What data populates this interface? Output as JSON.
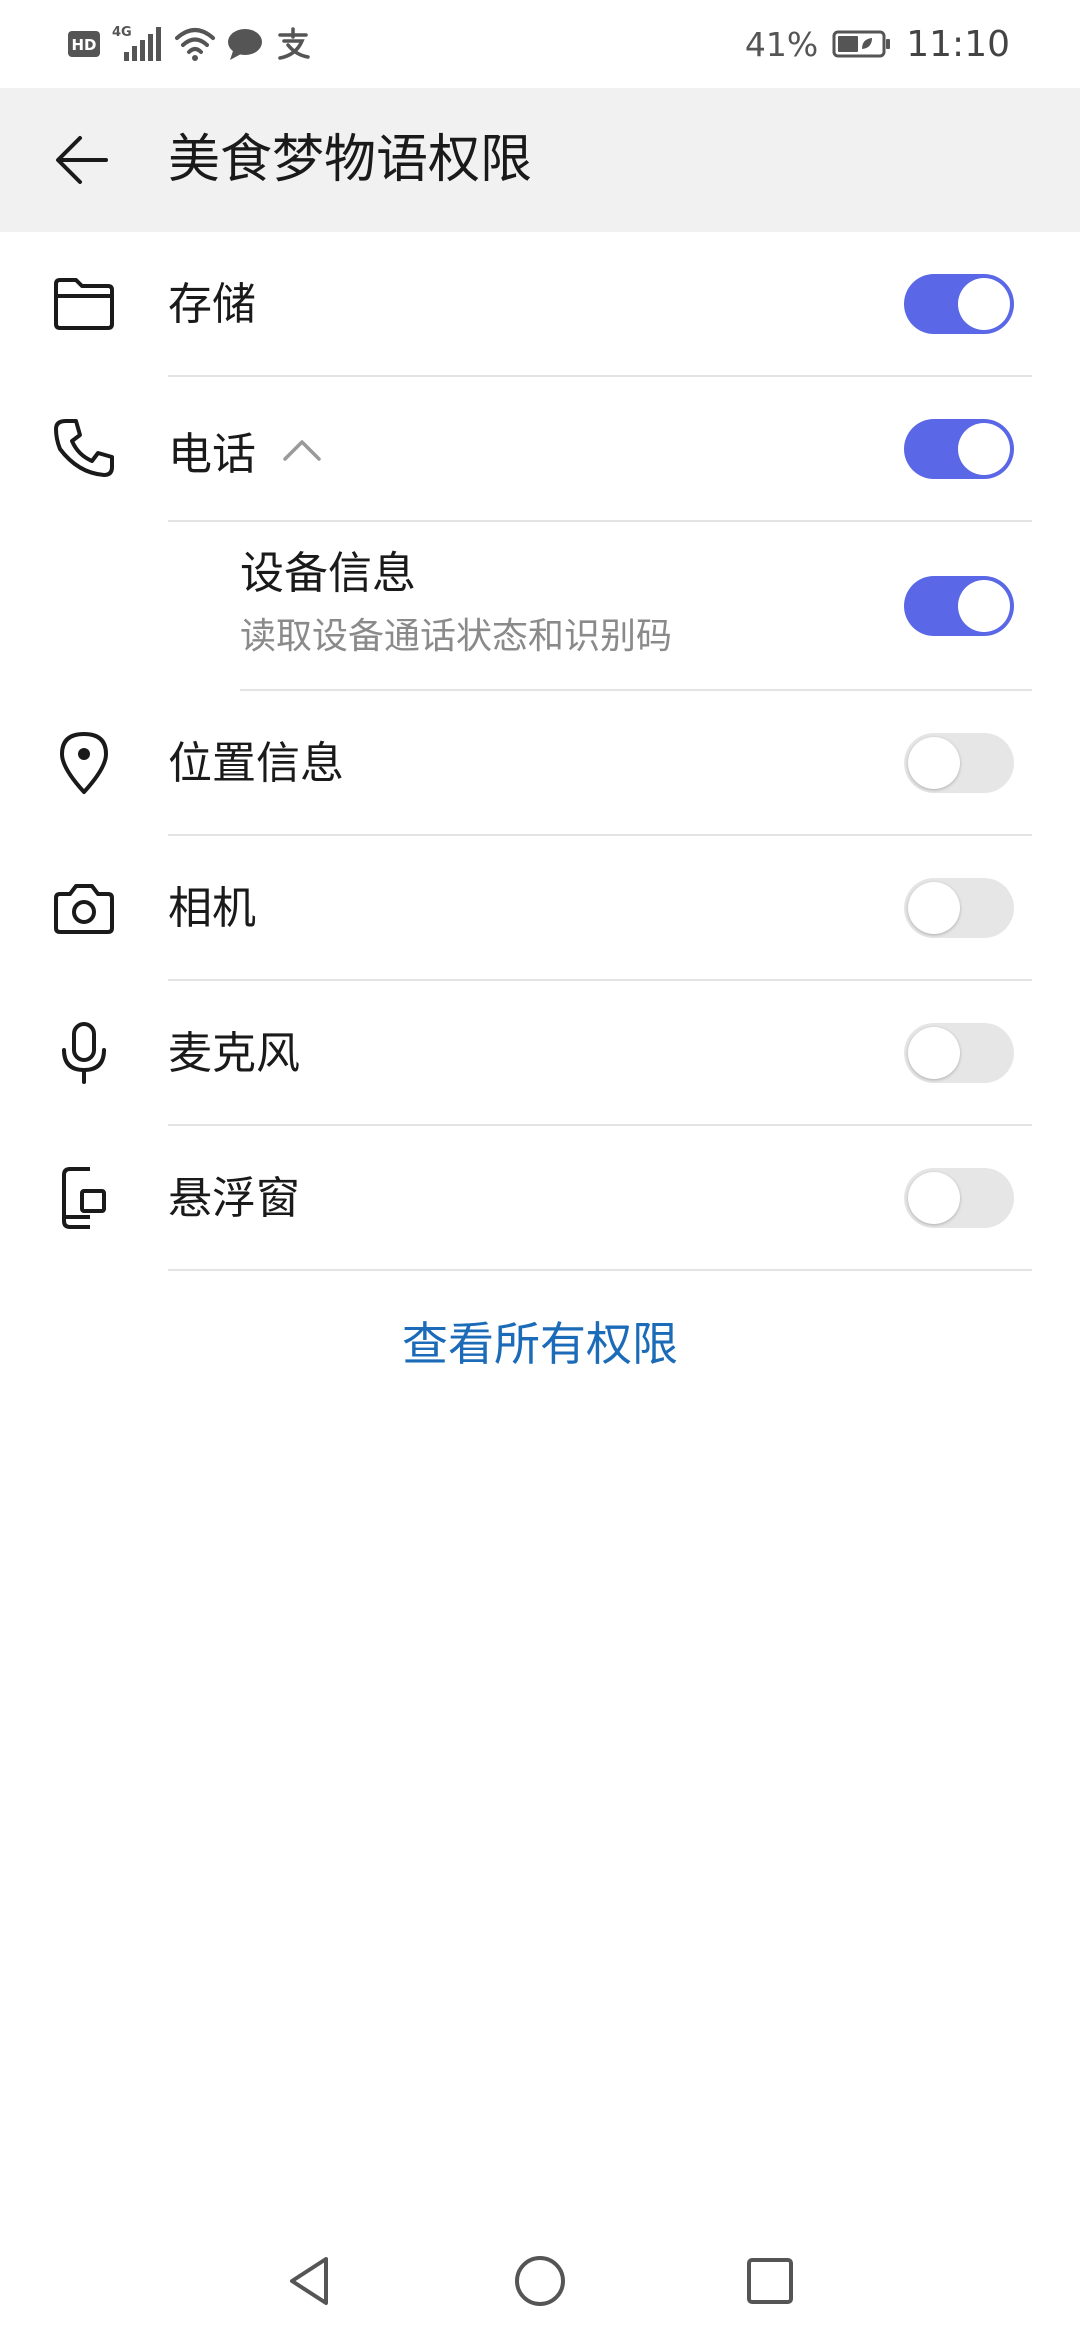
{
  "status_bar": {
    "left_icons": [
      "hd-icon",
      "signal-4g-icon",
      "wifi-icon",
      "message-bubble-icon",
      "alipay-icon"
    ],
    "hd_label": "HD",
    "network_label": "4G",
    "battery_percent": "41%",
    "time": "11:10"
  },
  "header": {
    "title": "美食梦物语权限",
    "back_icon": "back-arrow-icon"
  },
  "permissions": [
    {
      "icon": "folder-icon",
      "label": "存储",
      "enabled": true
    },
    {
      "icon": "phone-icon",
      "label": "电话",
      "enabled": true,
      "expanded": true
    },
    {
      "label": "设备信息",
      "description": "读取设备通话状态和识别码",
      "enabled": true,
      "sub_item": true
    },
    {
      "icon": "location-pin-icon",
      "label": "位置信息",
      "enabled": false
    },
    {
      "icon": "camera-icon",
      "label": "相机",
      "enabled": false
    },
    {
      "icon": "microphone-icon",
      "label": "麦克风",
      "enabled": false
    },
    {
      "icon": "floating-window-icon",
      "label": "悬浮窗",
      "enabled": false
    }
  ],
  "view_all_label": "查看所有权限",
  "colors": {
    "toggle_on": "#5a67e6",
    "toggle_off": "#e6e6e6",
    "link": "#1b6bb8",
    "header_bg": "#f1f1f1"
  },
  "nav_bar": {
    "icons": [
      "nav-back-icon",
      "nav-home-icon",
      "nav-recents-icon"
    ]
  }
}
